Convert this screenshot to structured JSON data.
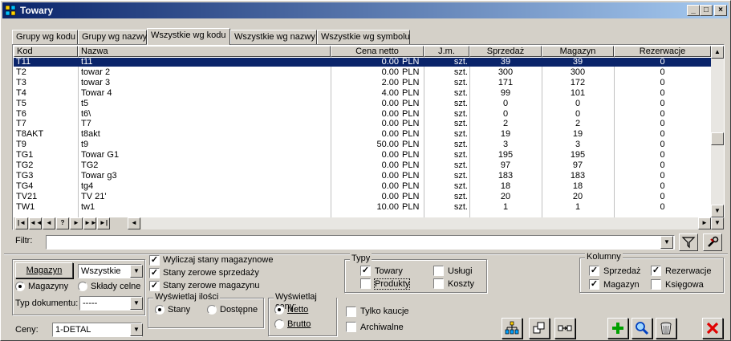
{
  "window": {
    "title": "Towary"
  },
  "tabs": [
    "Grupy wg kodu",
    "Grupy wg nazwy",
    "Wszystkie wg kodu",
    "Wszystkie wg nazwy",
    "Wszystkie wg symbolu"
  ],
  "active_tab": 2,
  "table": {
    "columns": [
      "Kod",
      "Nazwa",
      "Cena netto",
      "J.m.",
      "Sprzedaż",
      "Magazyn",
      "Rezerwacje"
    ],
    "rows": [
      {
        "kod": "T11",
        "nazwa": "t11",
        "cena": "0.00",
        "waluta": "PLN",
        "jm": "szt.",
        "sprzedaz": "39",
        "magazyn": "39",
        "rezerwacje": "0"
      },
      {
        "kod": "T2",
        "nazwa": "towar 2",
        "cena": "0.00",
        "waluta": "PLN",
        "jm": "szt.",
        "sprzedaz": "300",
        "magazyn": "300",
        "rezerwacje": "0"
      },
      {
        "kod": "T3",
        "nazwa": "towar 3",
        "cena": "2.00",
        "waluta": "PLN",
        "jm": "szt.",
        "sprzedaz": "171",
        "magazyn": "172",
        "rezerwacje": "0"
      },
      {
        "kod": "T4",
        "nazwa": "Towar 4",
        "cena": "4.00",
        "waluta": "PLN",
        "jm": "szt.",
        "sprzedaz": "99",
        "magazyn": "101",
        "rezerwacje": "0"
      },
      {
        "kod": "T5",
        "nazwa": "t5",
        "cena": "0.00",
        "waluta": "PLN",
        "jm": "szt.",
        "sprzedaz": "0",
        "magazyn": "0",
        "rezerwacje": "0"
      },
      {
        "kod": "T6",
        "nazwa": "t6\\",
        "cena": "0.00",
        "waluta": "PLN",
        "jm": "szt.",
        "sprzedaz": "0",
        "magazyn": "0",
        "rezerwacje": "0"
      },
      {
        "kod": "T7",
        "nazwa": "T7",
        "cena": "0.00",
        "waluta": "PLN",
        "jm": "szt.",
        "sprzedaz": "2",
        "magazyn": "2",
        "rezerwacje": "0"
      },
      {
        "kod": "T8AKT",
        "nazwa": "t8akt",
        "cena": "0.00",
        "waluta": "PLN",
        "jm": "szt.",
        "sprzedaz": "19",
        "magazyn": "19",
        "rezerwacje": "0"
      },
      {
        "kod": "T9",
        "nazwa": "t9",
        "cena": "50.00",
        "waluta": "PLN",
        "jm": "szt.",
        "sprzedaz": "3",
        "magazyn": "3",
        "rezerwacje": "0"
      },
      {
        "kod": "TG1",
        "nazwa": "Towar G1",
        "cena": "0.00",
        "waluta": "PLN",
        "jm": "szt.",
        "sprzedaz": "195",
        "magazyn": "195",
        "rezerwacje": "0"
      },
      {
        "kod": "TG2",
        "nazwa": "TG2",
        "cena": "0.00",
        "waluta": "PLN",
        "jm": "szt.",
        "sprzedaz": "97",
        "magazyn": "97",
        "rezerwacje": "0"
      },
      {
        "kod": "TG3",
        "nazwa": "Towar g3",
        "cena": "0.00",
        "waluta": "PLN",
        "jm": "szt.",
        "sprzedaz": "183",
        "magazyn": "183",
        "rezerwacje": "0"
      },
      {
        "kod": "TG4",
        "nazwa": "tg4",
        "cena": "0.00",
        "waluta": "PLN",
        "jm": "szt.",
        "sprzedaz": "18",
        "magazyn": "18",
        "rezerwacje": "0"
      },
      {
        "kod": "TV21",
        "nazwa": "TV 21'",
        "cena": "0.00",
        "waluta": "PLN",
        "jm": "szt.",
        "sprzedaz": "20",
        "magazyn": "20",
        "rezerwacje": "0"
      },
      {
        "kod": "TW1",
        "nazwa": "tw1",
        "cena": "10.00",
        "waluta": "PLN",
        "jm": "szt.",
        "sprzedaz": "1",
        "magazyn": "1",
        "rezerwacje": "0"
      }
    ],
    "selected_row": 0
  },
  "nav_buttons": [
    "|◄",
    "◄◄",
    "◄",
    "?",
    "►",
    "►►",
    "►|"
  ],
  "filter": {
    "label": "Filtr:",
    "value": ""
  },
  "magazyn": {
    "button_label": "Magazyn",
    "combo_value": "Wszystkie",
    "radio_magazyny": "Magazyny",
    "radio_sklady": "Składy celne",
    "typ_label": "Typ dokumentu:",
    "typ_value": "-----",
    "ceny_label": "Ceny:",
    "ceny_value": "1-DETAL"
  },
  "options": {
    "wyliczaj": "Wyliczaj stany magazynowe",
    "zerowe_sprzedazy": "Stany zerowe sprzedaży",
    "zerowe_magazynu": "Stany zerowe magazynu"
  },
  "wyswietlaj_ilosci": {
    "title": "Wyświetlaj ilości",
    "stany": "Stany",
    "dostepne": "Dostępne"
  },
  "wyswietlaj_ceny": {
    "title": "Wyświetlaj ceny:",
    "netto": "Netto",
    "brutto": "Brutto"
  },
  "typy": {
    "title": "Typy",
    "towary": "Towary",
    "uslugi": "Usługi",
    "produkty": "Produkty",
    "koszty": "Koszty"
  },
  "tylko_kaucje": "Tylko kaucje",
  "archiwalne": "Archiwalne",
  "kolumny": {
    "title": "Kolumny",
    "sprzedaz": "Sprzedaż",
    "rezerwacje": "Rezerwacje",
    "magazyn": "Magazyn",
    "ksiegowa": "Księgowa"
  },
  "colors": {
    "title_start": "#0a246a",
    "title_end": "#a6caf0",
    "selection": "#0a246a",
    "add_green": "#00a000",
    "close_red": "#e00000"
  }
}
